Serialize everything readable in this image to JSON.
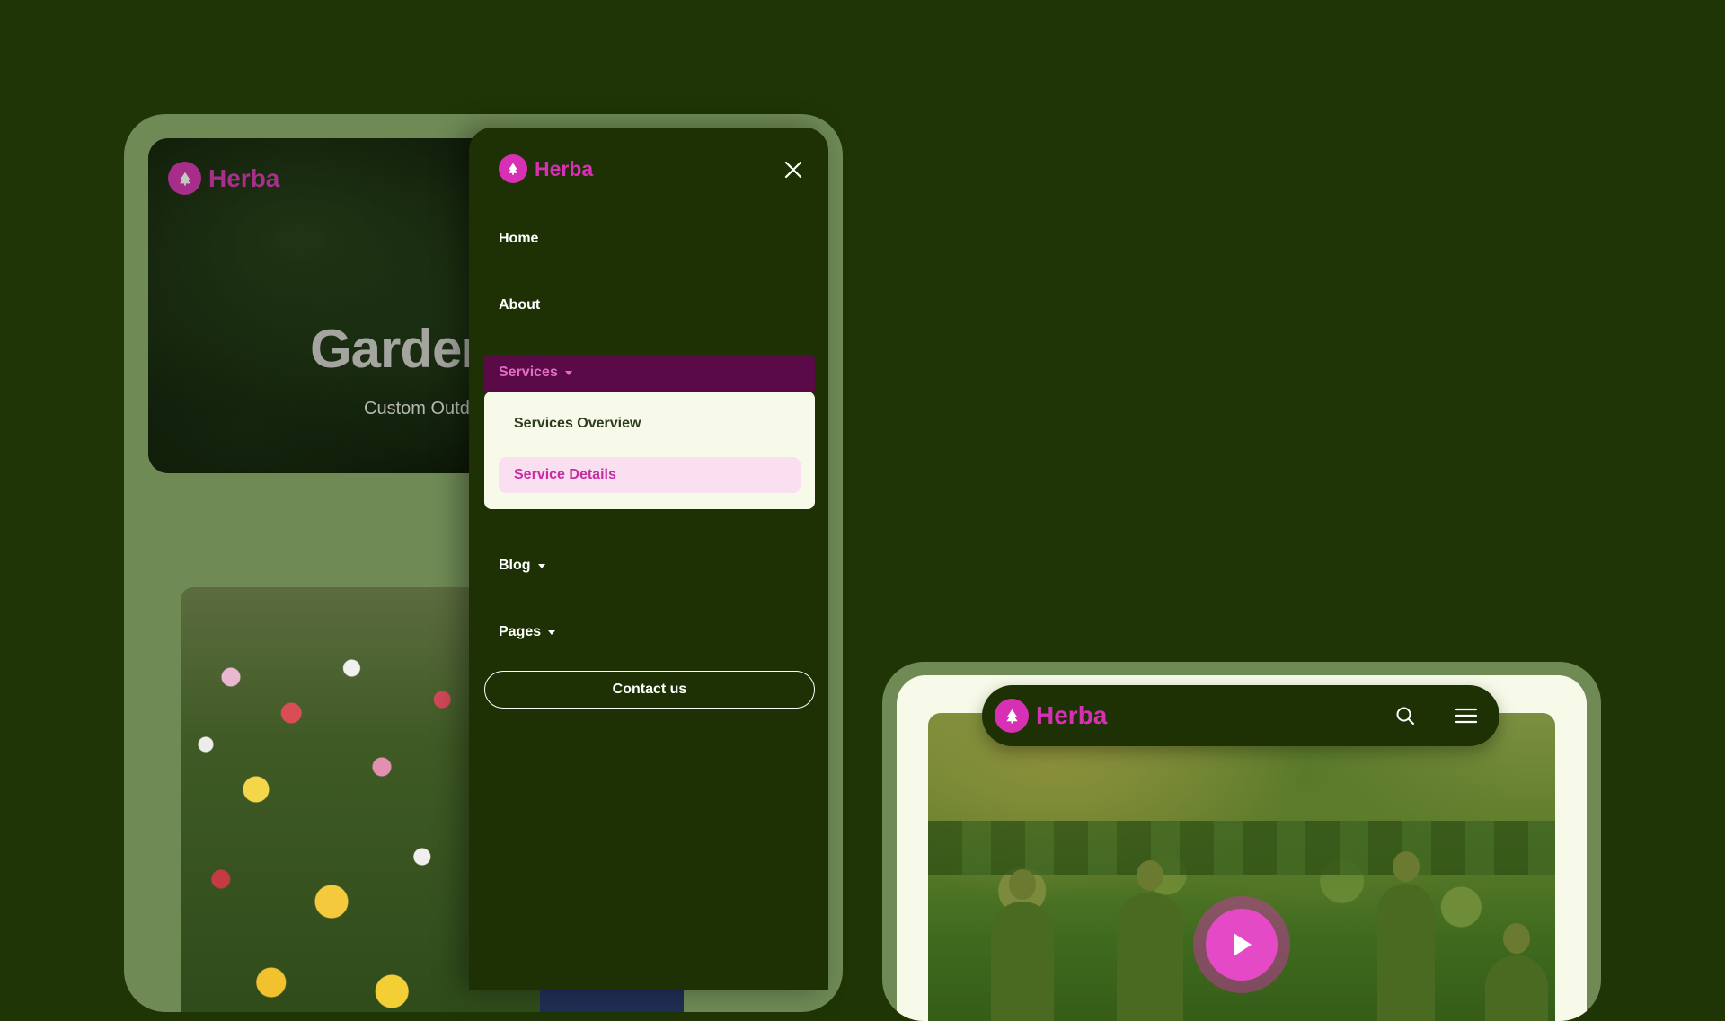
{
  "brand": {
    "name": "Herba",
    "accent_color": "#d830b4",
    "background_color": "#1f3505",
    "logo_icon": "tree-icon"
  },
  "left_device": {
    "hero_title": "Garden",
    "hero_subtitle": "Custom Outdoo"
  },
  "mobile_menu": {
    "items": [
      {
        "label": "Home"
      },
      {
        "label": "About"
      },
      {
        "label": "Services",
        "expanded": true
      },
      {
        "label": "Blog",
        "has_dropdown": true
      },
      {
        "label": "Pages",
        "has_dropdown": true
      }
    ],
    "services_submenu": [
      {
        "label": "Services Overview",
        "active": false
      },
      {
        "label": "Service Details",
        "active": true
      }
    ],
    "contact_button": "Contact us",
    "close_icon": "close-icon"
  },
  "right_device": {
    "header_icons": [
      "search-icon",
      "hamburger-menu-icon"
    ],
    "play_icon": "play-icon"
  }
}
